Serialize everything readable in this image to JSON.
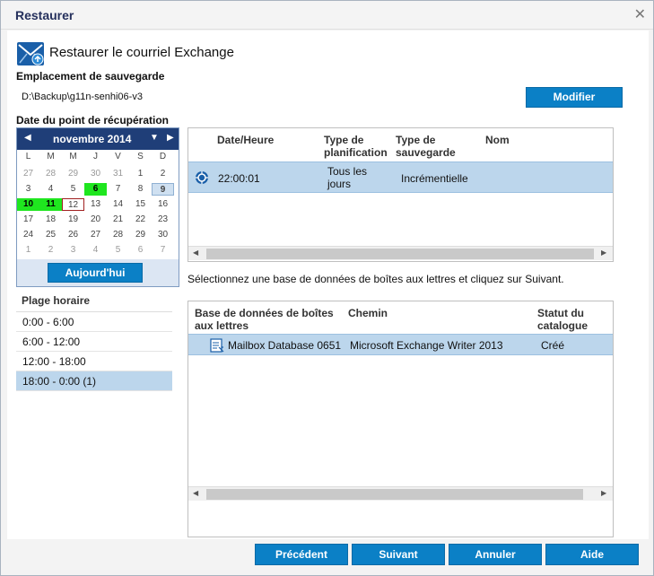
{
  "window": {
    "title": "Restaurer",
    "close_glyph": "✕"
  },
  "header": {
    "title": "Restaurer le courriel Exchange",
    "icon": "restore-mail-icon"
  },
  "backup": {
    "label": "Emplacement de sauvegarde",
    "path": "D:\\Backup\\g11n-senhi06-v3",
    "modify_label": "Modifier"
  },
  "recovery": {
    "label": "Date du point de récupération"
  },
  "calendar": {
    "month": "novembre 2014",
    "days": [
      "L",
      "M",
      "M",
      "J",
      "V",
      "S",
      "D"
    ],
    "weeks": [
      [
        {
          "d": "27",
          "c": "o"
        },
        {
          "d": "28",
          "c": "o"
        },
        {
          "d": "29",
          "c": "o"
        },
        {
          "d": "30",
          "c": "o"
        },
        {
          "d": "31",
          "c": "o"
        },
        {
          "d": "1",
          "c": ""
        },
        {
          "d": "2",
          "c": ""
        }
      ],
      [
        {
          "d": "3",
          "c": ""
        },
        {
          "d": "4",
          "c": ""
        },
        {
          "d": "5",
          "c": ""
        },
        {
          "d": "6",
          "c": "g"
        },
        {
          "d": "7",
          "c": ""
        },
        {
          "d": "8",
          "c": ""
        },
        {
          "d": "9",
          "c": "sat"
        }
      ],
      [
        {
          "d": "10",
          "c": "g"
        },
        {
          "d": "11",
          "c": "g"
        },
        {
          "d": "12",
          "c": "sel"
        },
        {
          "d": "13",
          "c": ""
        },
        {
          "d": "14",
          "c": ""
        },
        {
          "d": "15",
          "c": ""
        },
        {
          "d": "16",
          "c": ""
        }
      ],
      [
        {
          "d": "17",
          "c": ""
        },
        {
          "d": "18",
          "c": ""
        },
        {
          "d": "19",
          "c": ""
        },
        {
          "d": "20",
          "c": ""
        },
        {
          "d": "21",
          "c": ""
        },
        {
          "d": "22",
          "c": ""
        },
        {
          "d": "23",
          "c": ""
        }
      ],
      [
        {
          "d": "24",
          "c": ""
        },
        {
          "d": "25",
          "c": ""
        },
        {
          "d": "26",
          "c": ""
        },
        {
          "d": "27",
          "c": ""
        },
        {
          "d": "28",
          "c": ""
        },
        {
          "d": "29",
          "c": ""
        },
        {
          "d": "30",
          "c": ""
        }
      ],
      [
        {
          "d": "1",
          "c": "o"
        },
        {
          "d": "2",
          "c": "o"
        },
        {
          "d": "3",
          "c": "o"
        },
        {
          "d": "4",
          "c": "o"
        },
        {
          "d": "5",
          "c": "o"
        },
        {
          "d": "6",
          "c": "o"
        },
        {
          "d": "7",
          "c": "o"
        }
      ]
    ],
    "today_label": "Aujourd'hui"
  },
  "plage": {
    "header": "Plage horaire",
    "items": [
      "0:00 - 6:00",
      "6:00 - 12:00",
      "12:00 - 18:00",
      "18:00 - 0:00   (1)"
    ]
  },
  "points": {
    "columns": [
      "Date/Heure",
      "Type de planification",
      "Type de sauvegarde",
      "Nom"
    ],
    "row": {
      "time": "22:00:01",
      "schedule": "Tous les jours",
      "type": "Incrémentielle",
      "name": ""
    }
  },
  "instruction": "Sélectionnez une base de données de boîtes aux lettres et cliquez sur Suivant.",
  "databases": {
    "columns": [
      "Base de données de boîtes aux lettres",
      "Chemin",
      "Statut du catalogue"
    ],
    "row": {
      "name": "Mailbox Database 0651",
      "path": "Microsoft Exchange Writer 2013",
      "status": "Créé"
    }
  },
  "footer": {
    "prev": "Précédent",
    "next": "Suivant",
    "cancel": "Annuler",
    "help": "Aide"
  }
}
